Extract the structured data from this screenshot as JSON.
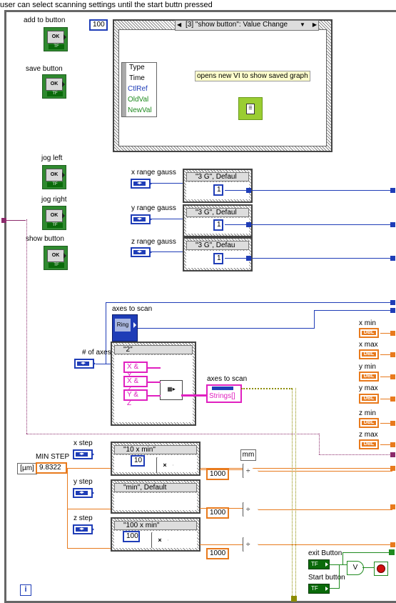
{
  "comment_title": "user can select scanning settings until the start buttn pressed",
  "buttons": {
    "add_to_button": "add to button",
    "save_button": "save button",
    "jog_left": "jog left",
    "jog_right": "jog right",
    "show_button": "show button",
    "ok_text": "OK",
    "tf_text": "TF"
  },
  "event_structure": {
    "timeout_value": "100",
    "case_label": "[3] \"show button\": Value Change",
    "event_items": [
      "Type",
      "Time",
      "CtlRef",
      "OldVal",
      "NewVal"
    ],
    "comment": "opens new VI to show saved graph"
  },
  "gauss": {
    "x_label": "x range gauss",
    "y_label": "y range gauss",
    "z_label": "z range gauss",
    "x_case": "\"3 G\", Defaul",
    "y_case": "\"3 G\", Defaul",
    "z_case": "\"3 G\", Defau",
    "const": "1"
  },
  "axes": {
    "ring_label": "axes to scan",
    "ring_text": "Ring",
    "num_axes_label": "# of axes",
    "case_label": "\"2\"",
    "options": [
      "X & Y",
      "X & Z",
      "Y & Z"
    ],
    "out_label": "axes to scan",
    "out_type": "Strings[]"
  },
  "limits": {
    "labels": [
      "x min",
      "x max",
      "y min",
      "y max",
      "z min",
      "z max"
    ],
    "type_text": "DBL"
  },
  "steps": {
    "min_step_label": "MIN STEP",
    "unit": "[µm]",
    "min_step_value": "9.8322",
    "x_step_label": "x step",
    "y_step_label": "y step",
    "z_step_label": "z step",
    "x_case": "\"10 x min\"",
    "y_case": "\"min\", Default",
    "z_case": "\"100 x min\"",
    "x_mult": "10",
    "z_mult": "100",
    "div_const": "1000",
    "mm_label": "mm"
  },
  "exit": {
    "exit_label": "exit Button",
    "start_label": "Start button",
    "tf_text": "TF",
    "or_text": "V"
  },
  "info_icon": "i"
}
